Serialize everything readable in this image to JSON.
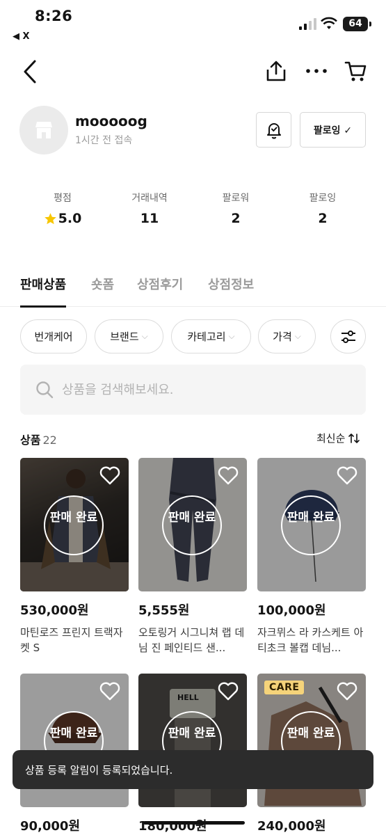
{
  "status": {
    "time": "8:26",
    "back_app": "◀ X",
    "battery": "64"
  },
  "profile": {
    "name": "mooooog",
    "last_seen": "1시간 전 접속",
    "follow_label": "팔로잉 ✓"
  },
  "stats": [
    {
      "label": "평점",
      "value": "5.0"
    },
    {
      "label": "거래내역",
      "value": "11"
    },
    {
      "label": "팔로워",
      "value": "2"
    },
    {
      "label": "팔로잉",
      "value": "2"
    }
  ],
  "tabs": [
    {
      "label": "판매상품"
    },
    {
      "label": "숏폼"
    },
    {
      "label": "상점후기"
    },
    {
      "label": "상점정보"
    }
  ],
  "filters": [
    {
      "label": "번개케어"
    },
    {
      "label": "브랜드"
    },
    {
      "label": "카테고리"
    },
    {
      "label": "가격"
    }
  ],
  "search": {
    "placeholder": "상품을 검색해보세요."
  },
  "products_header": {
    "label": "상품",
    "count": "22",
    "sort": "최신순"
  },
  "sold_label": "판매\n완료",
  "products": [
    {
      "price": "530,000원",
      "title": "마틴로즈 프린지 트랙자켓 S",
      "sold": "판매 완료"
    },
    {
      "price": "5,555원",
      "title": "오토링거 시그니쳐 랩 데님 진 페인티드 샌...",
      "sold": "판매 완료"
    },
    {
      "price": "100,000원",
      "title": "자크뮈스 라 카스케트 아티초크 볼캡 데님...",
      "sold": "판매 완료"
    },
    {
      "price": "90,000원",
      "title": "",
      "sold": "판매 완료"
    },
    {
      "price": "180,000원",
      "title": "",
      "sold": "판매 완료",
      "image_text": "HELL"
    },
    {
      "price": "240,000원",
      "title": "",
      "sold": "판매 완료",
      "badge": "CARE"
    }
  ],
  "toast": {
    "message": "상품 등록 알림이 등록되었습니다."
  },
  "colors": {
    "accent_star": "#f7c600",
    "toast_bg": "#2c2c2c",
    "care_badge": "#f5d37a"
  },
  "icons": [
    "back-arrow-icon",
    "share-icon",
    "more-icon",
    "cart-icon",
    "store-icon",
    "bell-check-icon",
    "star-icon",
    "settings-sliders-icon",
    "search-icon",
    "sort-icon",
    "heart-icon"
  ]
}
